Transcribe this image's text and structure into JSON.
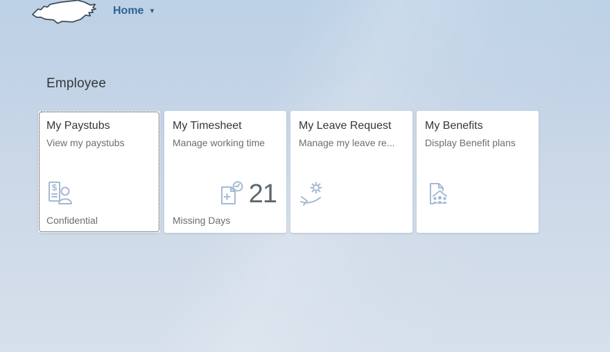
{
  "header": {
    "nav_label": "Home",
    "caret": "▼",
    "logo": "north-carolina-state-outline"
  },
  "section": {
    "title": "Employee"
  },
  "tiles": [
    {
      "title": "My Paystubs",
      "subtitle": "View my paystubs",
      "footer": "Confidential",
      "icon": "paystub-document-person-icon",
      "focused": true
    },
    {
      "title": "My Timesheet",
      "subtitle": "Manage working time",
      "footer": "Missing Days",
      "icon": "add-document-clock-icon",
      "value": "21"
    },
    {
      "title": "My Leave Request",
      "subtitle": "Manage my leave re...",
      "footer": "",
      "icon": "sun-lounger-vacation-icon"
    },
    {
      "title": "My Benefits",
      "subtitle": "Display Benefit plans",
      "footer": "",
      "icon": "family-document-icon"
    }
  ],
  "colors": {
    "background_top": "#bdd2e6",
    "background_bottom": "#d6e0eb",
    "tile_background": "#ffffff",
    "accent_link": "#2e6191",
    "tile_title": "#32363a",
    "tile_subtitle": "#6a6d70",
    "icon_blue": "#a4bad2",
    "kpi_number_gray": "#5d686e"
  }
}
